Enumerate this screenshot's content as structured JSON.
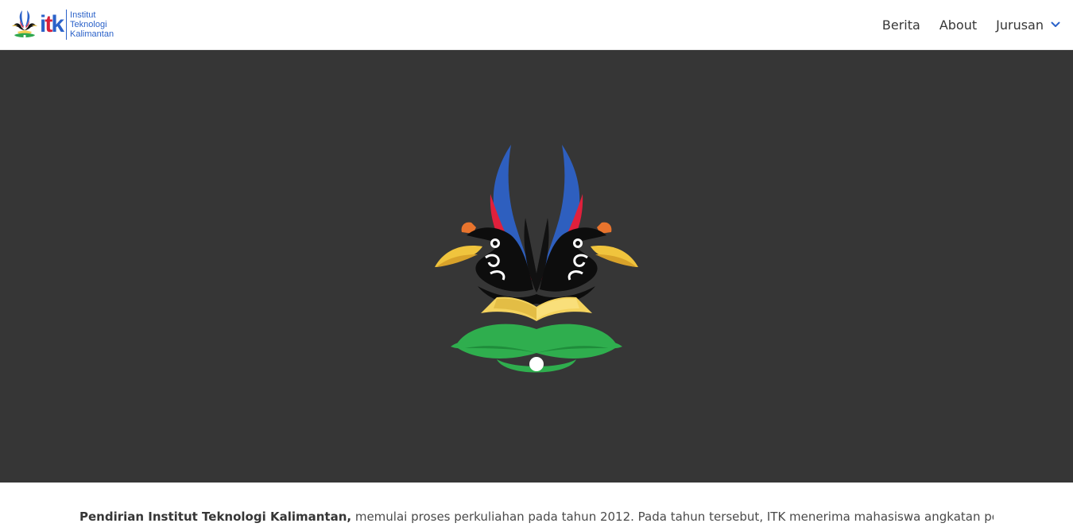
{
  "brand": {
    "mark": [
      "i",
      "t",
      "k"
    ],
    "lines": [
      "Institut",
      "Teknologi",
      "Kalimantan"
    ],
    "colors": {
      "blue": "#2b62c9",
      "red": "#d81f3a"
    }
  },
  "nav": {
    "items": [
      {
        "label": "Berita"
      },
      {
        "label": "About"
      },
      {
        "label": "Jurusan",
        "icon": "chevron-down-icon"
      }
    ]
  },
  "hero": {
    "background": "#363636",
    "logo": "itk-hornbill-emblem"
  },
  "article": {
    "lead": "Pendirian Institut Teknologi Kalimantan,",
    "body": " memulai proses perkuliahan pada tahun 2012. Pada tahun tersebut, ITK menerima mahasiswa angkatan pertama"
  }
}
